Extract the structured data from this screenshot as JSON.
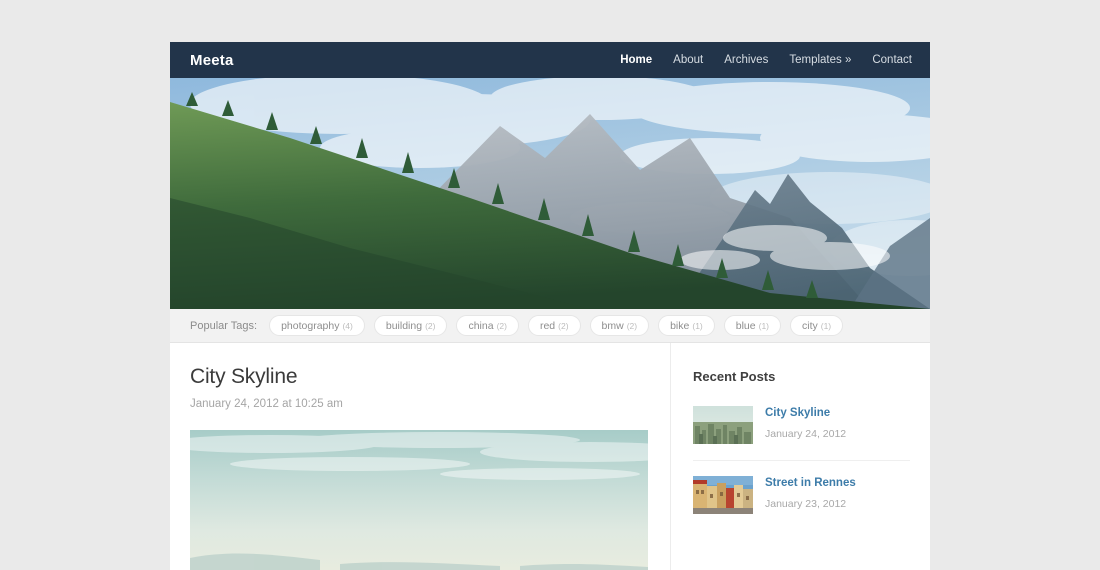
{
  "theme": {
    "header_bg": "#22344a",
    "page_bg": "#eaeaea",
    "card_bg": "#ffffff",
    "link_color": "#3d7ca9",
    "muted_text": "#a5a5a5",
    "tags_bar_bg": "#f2f2f2"
  },
  "header": {
    "logo": "Meeta",
    "nav": [
      {
        "label": "Home",
        "active": true
      },
      {
        "label": "About",
        "active": false
      },
      {
        "label": "Archives",
        "active": false
      },
      {
        "label": "Templates »",
        "active": false
      },
      {
        "label": "Contact",
        "active": false
      }
    ]
  },
  "hero": {
    "alt": "mountain-forest-banner"
  },
  "tags": {
    "label": "Popular Tags:",
    "items": [
      {
        "name": "photography",
        "count": "(4)"
      },
      {
        "name": "building",
        "count": "(2)"
      },
      {
        "name": "china",
        "count": "(2)"
      },
      {
        "name": "red",
        "count": "(2)"
      },
      {
        "name": "bmw",
        "count": "(2)"
      },
      {
        "name": "bike",
        "count": "(1)"
      },
      {
        "name": "blue",
        "count": "(1)"
      },
      {
        "name": "city",
        "count": "(1)"
      }
    ]
  },
  "post": {
    "title": "City Skyline",
    "date": "January 24, 2012 at 10:25 am",
    "featured_image_alt": "hazy-teal-sky-over-distant-hills"
  },
  "sidebar": {
    "widget_title": "Recent Posts",
    "items": [
      {
        "title": "City Skyline",
        "date": "January 24, 2012",
        "thumb_alt": "city-skyline-thumbnail"
      },
      {
        "title": "Street in Rennes",
        "date": "January 23, 2012",
        "thumb_alt": "street-in-rennes-thumbnail"
      }
    ]
  }
}
